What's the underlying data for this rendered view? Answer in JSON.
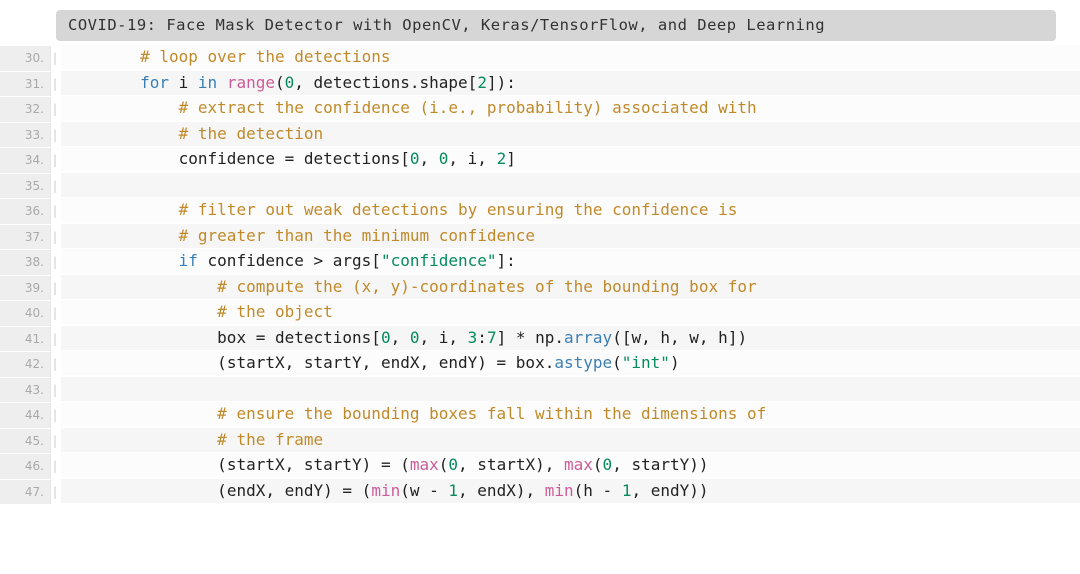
{
  "title": "COVID-19: Face Mask Detector with OpenCV, Keras/TensorFlow, and Deep Learning",
  "gutter_sep": "|",
  "lines": [
    {
      "num": "30.",
      "tokens": [
        {
          "c": "tk-ident",
          "t": "        "
        },
        {
          "c": "tk-comment",
          "t": "# loop over the detections"
        }
      ]
    },
    {
      "num": "31.",
      "tokens": [
        {
          "c": "tk-ident",
          "t": "        "
        },
        {
          "c": "tk-keyword",
          "t": "for"
        },
        {
          "c": "tk-ident",
          "t": " i "
        },
        {
          "c": "tk-keyword",
          "t": "in"
        },
        {
          "c": "tk-ident",
          "t": " "
        },
        {
          "c": "tk-builtin",
          "t": "range"
        },
        {
          "c": "tk-op",
          "t": "("
        },
        {
          "c": "tk-number",
          "t": "0"
        },
        {
          "c": "tk-op",
          "t": ", "
        },
        {
          "c": "tk-ident",
          "t": "detections.shape"
        },
        {
          "c": "tk-op",
          "t": "["
        },
        {
          "c": "tk-number",
          "t": "2"
        },
        {
          "c": "tk-op",
          "t": "]):"
        }
      ]
    },
    {
      "num": "32.",
      "tokens": [
        {
          "c": "tk-ident",
          "t": "            "
        },
        {
          "c": "tk-comment",
          "t": "# extract the confidence (i.e., probability) associated with"
        }
      ]
    },
    {
      "num": "33.",
      "tokens": [
        {
          "c": "tk-ident",
          "t": "            "
        },
        {
          "c": "tk-comment",
          "t": "# the detection"
        }
      ]
    },
    {
      "num": "34.",
      "tokens": [
        {
          "c": "tk-ident",
          "t": "            confidence "
        },
        {
          "c": "tk-op",
          "t": "= "
        },
        {
          "c": "tk-ident",
          "t": "detections"
        },
        {
          "c": "tk-op",
          "t": "["
        },
        {
          "c": "tk-number",
          "t": "0"
        },
        {
          "c": "tk-op",
          "t": ", "
        },
        {
          "c": "tk-number",
          "t": "0"
        },
        {
          "c": "tk-op",
          "t": ", "
        },
        {
          "c": "tk-ident",
          "t": "i"
        },
        {
          "c": "tk-op",
          "t": ", "
        },
        {
          "c": "tk-number",
          "t": "2"
        },
        {
          "c": "tk-op",
          "t": "]"
        }
      ]
    },
    {
      "num": "35.",
      "tokens": [
        {
          "c": "tk-ident",
          "t": " "
        }
      ]
    },
    {
      "num": "36.",
      "tokens": [
        {
          "c": "tk-ident",
          "t": "            "
        },
        {
          "c": "tk-comment",
          "t": "# filter out weak detections by ensuring the confidence is"
        }
      ]
    },
    {
      "num": "37.",
      "tokens": [
        {
          "c": "tk-ident",
          "t": "            "
        },
        {
          "c": "tk-comment",
          "t": "# greater than the minimum confidence"
        }
      ]
    },
    {
      "num": "38.",
      "tokens": [
        {
          "c": "tk-ident",
          "t": "            "
        },
        {
          "c": "tk-keyword",
          "t": "if"
        },
        {
          "c": "tk-ident",
          "t": " confidence "
        },
        {
          "c": "tk-op",
          "t": "> "
        },
        {
          "c": "tk-ident",
          "t": "args"
        },
        {
          "c": "tk-op",
          "t": "["
        },
        {
          "c": "tk-string",
          "t": "\"confidence\""
        },
        {
          "c": "tk-op",
          "t": "]:"
        }
      ]
    },
    {
      "num": "39.",
      "tokens": [
        {
          "c": "tk-ident",
          "t": "                "
        },
        {
          "c": "tk-comment",
          "t": "# compute the (x, y)-coordinates of the bounding box for"
        }
      ]
    },
    {
      "num": "40.",
      "tokens": [
        {
          "c": "tk-ident",
          "t": "                "
        },
        {
          "c": "tk-comment",
          "t": "# the object"
        }
      ]
    },
    {
      "num": "41.",
      "tokens": [
        {
          "c": "tk-ident",
          "t": "                box "
        },
        {
          "c": "tk-op",
          "t": "= "
        },
        {
          "c": "tk-ident",
          "t": "detections"
        },
        {
          "c": "tk-op",
          "t": "["
        },
        {
          "c": "tk-number",
          "t": "0"
        },
        {
          "c": "tk-op",
          "t": ", "
        },
        {
          "c": "tk-number",
          "t": "0"
        },
        {
          "c": "tk-op",
          "t": ", "
        },
        {
          "c": "tk-ident",
          "t": "i"
        },
        {
          "c": "tk-op",
          "t": ", "
        },
        {
          "c": "tk-number",
          "t": "3"
        },
        {
          "c": "tk-op",
          "t": ":"
        },
        {
          "c": "tk-number",
          "t": "7"
        },
        {
          "c": "tk-op",
          "t": "] * "
        },
        {
          "c": "tk-ident",
          "t": "np."
        },
        {
          "c": "tk-method",
          "t": "array"
        },
        {
          "c": "tk-op",
          "t": "(["
        },
        {
          "c": "tk-ident",
          "t": "w"
        },
        {
          "c": "tk-op",
          "t": ", "
        },
        {
          "c": "tk-ident",
          "t": "h"
        },
        {
          "c": "tk-op",
          "t": ", "
        },
        {
          "c": "tk-ident",
          "t": "w"
        },
        {
          "c": "tk-op",
          "t": ", "
        },
        {
          "c": "tk-ident",
          "t": "h"
        },
        {
          "c": "tk-op",
          "t": "])"
        }
      ]
    },
    {
      "num": "42.",
      "tokens": [
        {
          "c": "tk-ident",
          "t": "                "
        },
        {
          "c": "tk-op",
          "t": "("
        },
        {
          "c": "tk-ident",
          "t": "startX"
        },
        {
          "c": "tk-op",
          "t": ", "
        },
        {
          "c": "tk-ident",
          "t": "startY"
        },
        {
          "c": "tk-op",
          "t": ", "
        },
        {
          "c": "tk-ident",
          "t": "endX"
        },
        {
          "c": "tk-op",
          "t": ", "
        },
        {
          "c": "tk-ident",
          "t": "endY"
        },
        {
          "c": "tk-op",
          "t": ") = "
        },
        {
          "c": "tk-ident",
          "t": "box."
        },
        {
          "c": "tk-method",
          "t": "astype"
        },
        {
          "c": "tk-op",
          "t": "("
        },
        {
          "c": "tk-string",
          "t": "\"int\""
        },
        {
          "c": "tk-op",
          "t": ")"
        }
      ]
    },
    {
      "num": "43.",
      "tokens": [
        {
          "c": "tk-ident",
          "t": " "
        }
      ]
    },
    {
      "num": "44.",
      "tokens": [
        {
          "c": "tk-ident",
          "t": "                "
        },
        {
          "c": "tk-comment",
          "t": "# ensure the bounding boxes fall within the dimensions of"
        }
      ]
    },
    {
      "num": "45.",
      "tokens": [
        {
          "c": "tk-ident",
          "t": "                "
        },
        {
          "c": "tk-comment",
          "t": "# the frame"
        }
      ]
    },
    {
      "num": "46.",
      "tokens": [
        {
          "c": "tk-ident",
          "t": "                "
        },
        {
          "c": "tk-op",
          "t": "("
        },
        {
          "c": "tk-ident",
          "t": "startX"
        },
        {
          "c": "tk-op",
          "t": ", "
        },
        {
          "c": "tk-ident",
          "t": "startY"
        },
        {
          "c": "tk-op",
          "t": ") = ("
        },
        {
          "c": "tk-builtin",
          "t": "max"
        },
        {
          "c": "tk-op",
          "t": "("
        },
        {
          "c": "tk-number",
          "t": "0"
        },
        {
          "c": "tk-op",
          "t": ", "
        },
        {
          "c": "tk-ident",
          "t": "startX"
        },
        {
          "c": "tk-op",
          "t": "), "
        },
        {
          "c": "tk-builtin",
          "t": "max"
        },
        {
          "c": "tk-op",
          "t": "("
        },
        {
          "c": "tk-number",
          "t": "0"
        },
        {
          "c": "tk-op",
          "t": ", "
        },
        {
          "c": "tk-ident",
          "t": "startY"
        },
        {
          "c": "tk-op",
          "t": "))"
        }
      ]
    },
    {
      "num": "47.",
      "tokens": [
        {
          "c": "tk-ident",
          "t": "                "
        },
        {
          "c": "tk-op",
          "t": "("
        },
        {
          "c": "tk-ident",
          "t": "endX"
        },
        {
          "c": "tk-op",
          "t": ", "
        },
        {
          "c": "tk-ident",
          "t": "endY"
        },
        {
          "c": "tk-op",
          "t": ") = ("
        },
        {
          "c": "tk-builtin",
          "t": "min"
        },
        {
          "c": "tk-op",
          "t": "("
        },
        {
          "c": "tk-ident",
          "t": "w "
        },
        {
          "c": "tk-op",
          "t": "- "
        },
        {
          "c": "tk-number",
          "t": "1"
        },
        {
          "c": "tk-op",
          "t": ", "
        },
        {
          "c": "tk-ident",
          "t": "endX"
        },
        {
          "c": "tk-op",
          "t": "), "
        },
        {
          "c": "tk-builtin",
          "t": "min"
        },
        {
          "c": "tk-op",
          "t": "("
        },
        {
          "c": "tk-ident",
          "t": "h "
        },
        {
          "c": "tk-op",
          "t": "- "
        },
        {
          "c": "tk-number",
          "t": "1"
        },
        {
          "c": "tk-op",
          "t": ", "
        },
        {
          "c": "tk-ident",
          "t": "endY"
        },
        {
          "c": "tk-op",
          "t": "))"
        }
      ]
    }
  ]
}
